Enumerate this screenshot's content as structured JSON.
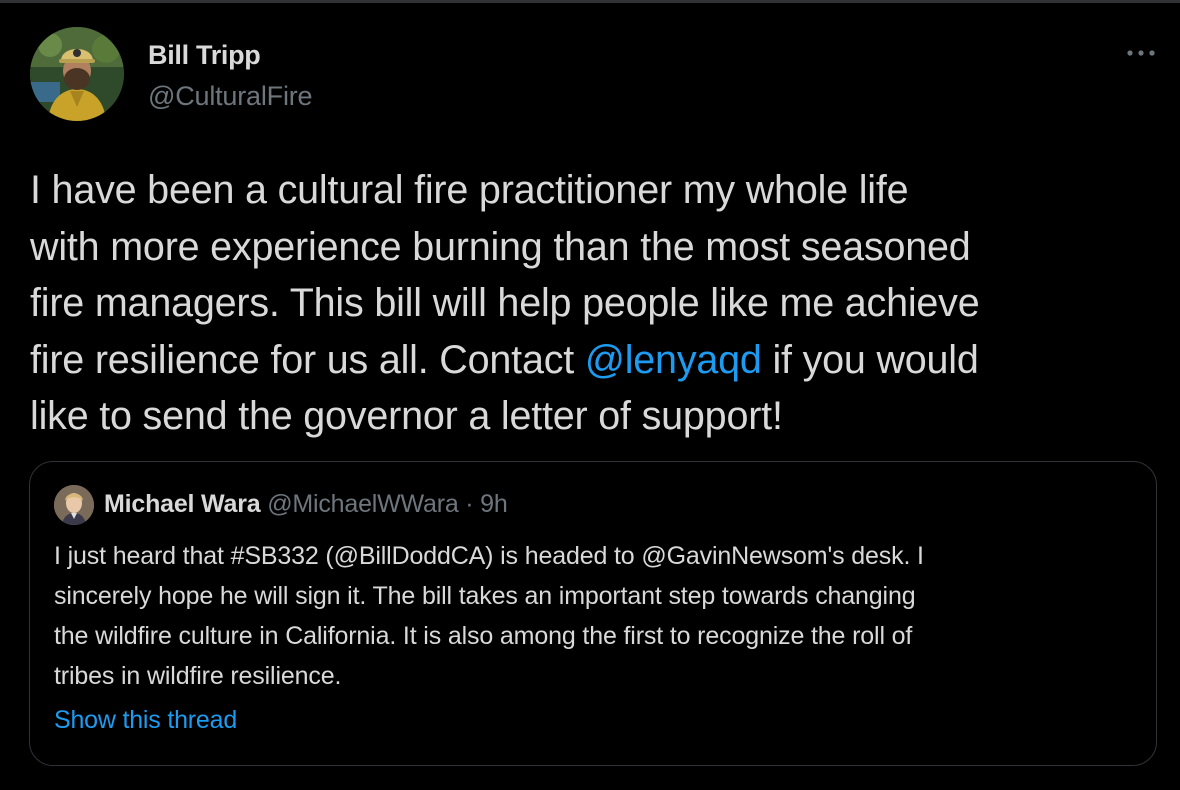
{
  "tweet": {
    "author": {
      "name": "Bill Tripp",
      "handle": "@CulturalFire"
    },
    "more_icon": "more-horizontal-icon",
    "text_lines": [
      {
        "before": "I have been a cultural fire practitioner my whole life",
        "mention": "",
        "after": ""
      },
      {
        "before": "with more experience burning than the most seasoned",
        "mention": "",
        "after": ""
      },
      {
        "before": "fire managers.  This bill will help people like me achieve",
        "mention": "",
        "after": ""
      },
      {
        "before": "fire resilience for us all. Contact ",
        "mention": "@lenyaqd",
        "after": " if you would"
      },
      {
        "before": "like to send the governor a letter of support!",
        "mention": "",
        "after": ""
      }
    ]
  },
  "quoted_tweet": {
    "author": {
      "name": "Michael Wara",
      "handle": "@MichaelWWara",
      "separator": "·",
      "time": "9h"
    },
    "text_lines": [
      "I just heard that #SB332 (@BillDoddCA) is headed to @GavinNewsom's desk. I",
      "sincerely hope he will sign it. The bill takes an important step towards changing",
      "the wildfire culture in California. It is also among the first to recognize the roll of",
      "tribes in wildfire resilience."
    ],
    "show_thread_label": "Show this thread"
  },
  "colors": {
    "background": "#000000",
    "text": "#d9d9d9",
    "secondary_text": "#6e767d",
    "link": "#1d9bf0",
    "border": "#2f3336"
  }
}
